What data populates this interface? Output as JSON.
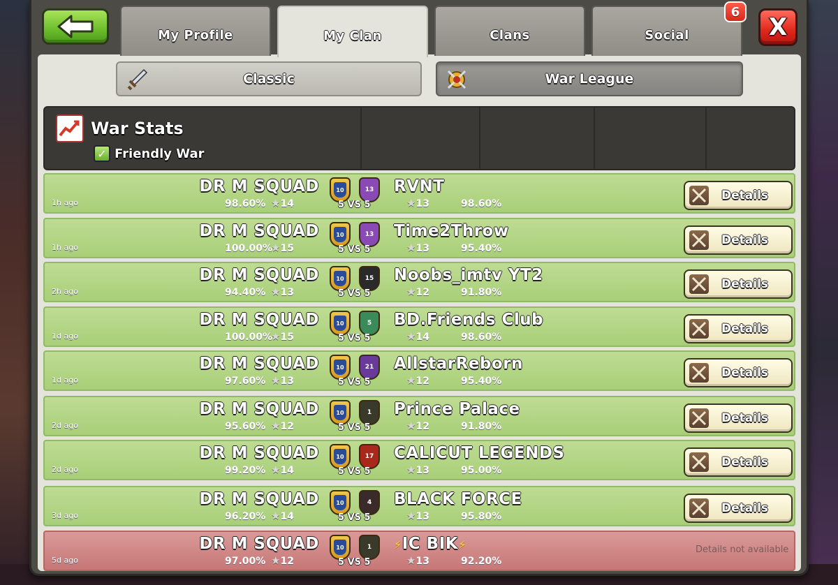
{
  "tabs": [
    {
      "label": "My Profile",
      "active": false
    },
    {
      "label": "My Clan",
      "active": true
    },
    {
      "label": "Clans",
      "active": false
    },
    {
      "label": "Social",
      "active": false,
      "badge": "6"
    }
  ],
  "subtabs": [
    {
      "label": "Classic",
      "selected": false,
      "icon": "sword-icon"
    },
    {
      "label": "War League",
      "selected": true,
      "icon": "crossed-swords-shield-icon"
    }
  ],
  "header": {
    "title": "War Stats",
    "filter_label": "Friendly War",
    "filter_checked": true
  },
  "colors": {
    "win_row": "#b3d685",
    "loss_row": "#d08888",
    "back_button": "#6cbd2c",
    "close_button": "#e0281c"
  },
  "wars": [
    {
      "age": "1h ago",
      "home": "DR M SQUAD",
      "home_pct": "98.60%",
      "home_stars": "14",
      "home_level": "10",
      "size": "5 VS 5",
      "opp": "RVNT",
      "opp_level": "13",
      "opp_badge_color": "#8a4ab6",
      "opp_stars": "13",
      "opp_pct": "98.60%",
      "result": "win",
      "details": "Details"
    },
    {
      "age": "1h ago",
      "home": "DR M SQUAD",
      "home_pct": "100.00%",
      "home_stars": "15",
      "home_level": "10",
      "size": "5 VS 5",
      "opp": "Time2Throw",
      "opp_level": "13",
      "opp_badge_color": "#8a4ab6",
      "opp_stars": "13",
      "opp_pct": "95.40%",
      "result": "win",
      "details": "Details"
    },
    {
      "age": "2h ago",
      "home": "DR M SQUAD",
      "home_pct": "94.40%",
      "home_stars": "13",
      "home_level": "10",
      "size": "5 VS 5",
      "opp": "Noobs_imtv YT2",
      "opp_level": "15",
      "opp_badge_color": "#2a2a2a",
      "opp_stars": "12",
      "opp_pct": "91.80%",
      "result": "win",
      "details": "Details"
    },
    {
      "age": "1d ago",
      "home": "DR M SQUAD",
      "home_pct": "100.00%",
      "home_stars": "15",
      "home_level": "10",
      "size": "5 VS 5",
      "opp": "BD.Friends Club",
      "opp_level": "5",
      "opp_badge_color": "#3a8a5a",
      "opp_stars": "14",
      "opp_pct": "98.60%",
      "result": "win",
      "details": "Details"
    },
    {
      "age": "1d ago",
      "home": "DR M SQUAD",
      "home_pct": "97.60%",
      "home_stars": "13",
      "home_level": "10",
      "size": "5 VS 5",
      "opp": "AllstarReborn",
      "opp_level": "21",
      "opp_badge_color": "#6a3a9a",
      "opp_stars": "12",
      "opp_pct": "95.40%",
      "result": "win",
      "details": "Details"
    },
    {
      "age": "2d ago",
      "home": "DR M SQUAD",
      "home_pct": "95.60%",
      "home_stars": "12",
      "home_level": "10",
      "size": "5 VS 5",
      "opp": "Prince Palace",
      "opp_level": "1",
      "opp_badge_color": "#3a3a2a",
      "opp_stars": "12",
      "opp_pct": "91.80%",
      "result": "win",
      "details": "Details"
    },
    {
      "age": "2d ago",
      "home": "DR M SQUAD",
      "home_pct": "99.20%",
      "home_stars": "14",
      "home_level": "10",
      "size": "5 VS 5",
      "opp": "CALICUT LEGENDS",
      "opp_level": "17",
      "opp_badge_color": "#a8281c",
      "opp_stars": "13",
      "opp_pct": "95.00%",
      "result": "win",
      "details": "Details"
    },
    {
      "age": "3d ago",
      "home": "DR M SQUAD",
      "home_pct": "96.20%",
      "home_stars": "14",
      "home_level": "10",
      "size": "5 VS 5",
      "opp": "BLACK FORCE",
      "opp_level": "4",
      "opp_badge_color": "#3a2a2a",
      "opp_stars": "13",
      "opp_pct": "95.80%",
      "result": "win",
      "details": "Details"
    },
    {
      "age": "5d ago",
      "home": "DR M SQUAD",
      "home_pct": "97.00%",
      "home_stars": "12",
      "home_level": "10",
      "size": "5 VS 5",
      "opp": "IC BIK",
      "opp_level": "1",
      "opp_badge_color": "#3a3a2a",
      "opp_stars": "13",
      "opp_pct": "92.20%",
      "result": "loss",
      "details": "Details not available",
      "opp_bolts": true
    }
  ]
}
